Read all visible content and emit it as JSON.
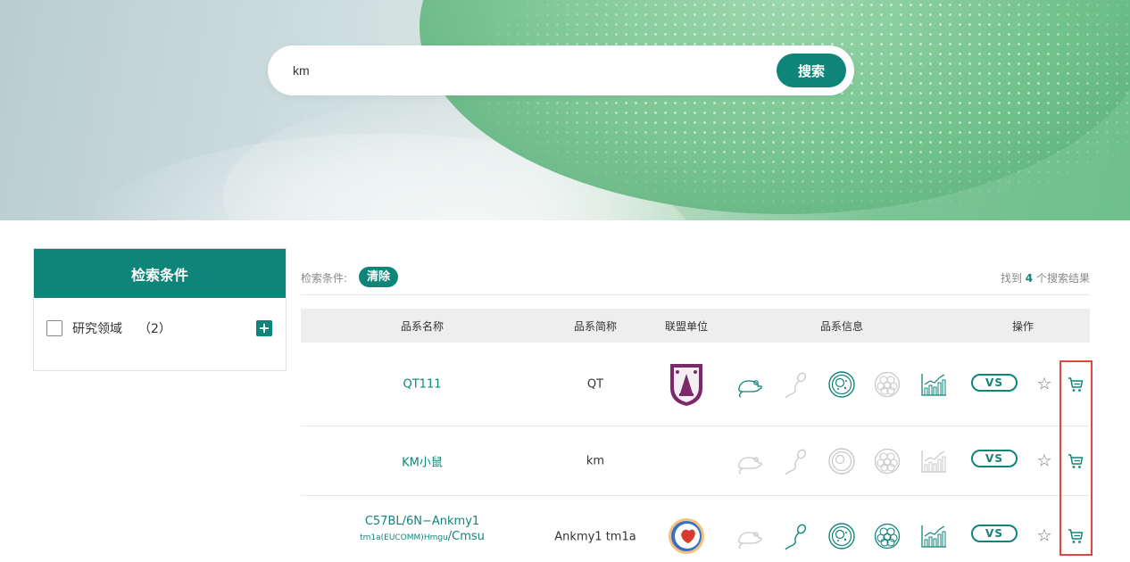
{
  "search": {
    "value": "km",
    "button_label": "搜索"
  },
  "sidebar": {
    "title": "检索条件",
    "filters": [
      {
        "label": "研究领域",
        "count": "（2）"
      }
    ]
  },
  "conditions": {
    "label": "检索条件:",
    "clear_label": "清除",
    "result_prefix": "找到",
    "result_count": "4",
    "result_suffix": "个搜索结果"
  },
  "table": {
    "headers": [
      "品系名称",
      "品系简称",
      "联盟单位",
      "品系信息",
      "操作"
    ],
    "rows": [
      {
        "name": "QT111",
        "name_sub": "",
        "name_suffix": "",
        "abbr": "QT",
        "unit_logo": "njau-logo",
        "info_active": [
          "mouse-icon",
          "embryo-icon",
          "early-embryo-icon",
          "chart-icon"
        ],
        "vs": "VS"
      },
      {
        "name": "KM小鼠",
        "name_sub": "",
        "name_suffix": "",
        "abbr": "km",
        "unit_logo": "",
        "info_active": [],
        "vs": "VS"
      },
      {
        "name": "C57BL/6N−Ankmy1",
        "name_sub": "tm1a(EUCOMM)Hmgu",
        "name_suffix": "/Cmsu",
        "abbr": "Ankmy1 tm1a",
        "unit_logo": "red-logo",
        "info_active": [
          "sperm-icon",
          "embryo-icon",
          "early-embryo-icon",
          "chart-icon"
        ],
        "vs": "VS"
      }
    ]
  },
  "colors": {
    "accent": "#0f857a",
    "highlight": "#e2473f",
    "inactive_icon": "#c8c8c8"
  }
}
